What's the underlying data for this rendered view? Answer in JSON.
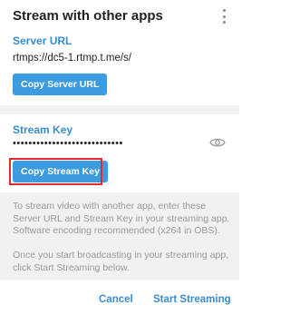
{
  "dialog": {
    "title": "Stream with other apps"
  },
  "server": {
    "label": "Server URL",
    "value": "rtmps://dc5-1.rtmp.t.me/s/",
    "copy_button": "Copy Server URL"
  },
  "stream_key": {
    "label": "Stream Key",
    "value": "••••••••••••••••••••••••••••",
    "copy_button": "Copy Stream Key"
  },
  "info": {
    "paragraph1": "To stream video with another app, enter these Server URL and Stream Key in your streaming app. Software encoding recommended (x264 in OBS).",
    "paragraph2": "Once you start broadcasting in your streaming app, click Start Streaming below."
  },
  "footer": {
    "cancel_label": "Cancel",
    "start_label": "Start Streaming"
  },
  "colors": {
    "accent": "#3a8ccd",
    "button_bg": "#3d9be0",
    "highlight": "#e32b2b",
    "info_bg": "#f1f1f1"
  },
  "icons": {
    "menu": "more-vertical-icon",
    "reveal": "eye-icon"
  }
}
